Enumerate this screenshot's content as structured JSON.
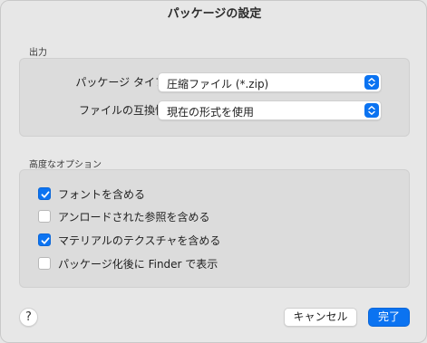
{
  "dialog": {
    "title": "パッケージの設定"
  },
  "output": {
    "section_title": "出力",
    "package_type": {
      "label": "パッケージ タイプ:",
      "value": "圧縮ファイル (*.zip)"
    },
    "compatibility": {
      "label": "ファイルの互換性:",
      "value": "現在の形式を使用"
    }
  },
  "advanced": {
    "section_title": "高度なオプション",
    "options": [
      {
        "label": "フォントを含める",
        "checked": true
      },
      {
        "label": "アンロードされた参照を含める",
        "checked": false
      },
      {
        "label": "マテリアルのテクスチャを含める",
        "checked": true
      },
      {
        "label": "パッケージ化後に Finder で表示",
        "checked": false
      }
    ]
  },
  "footer": {
    "help_label": "?",
    "cancel_label": "キャンセル",
    "done_label": "完了"
  },
  "colors": {
    "accent": "#0b73f1",
    "window_bg": "#e7e7e7",
    "group_bg": "#dcdcdc"
  },
  "icons": {
    "select_stepper": "up-down-chevron-icon",
    "checkbox_on": "checkmark-icon"
  }
}
